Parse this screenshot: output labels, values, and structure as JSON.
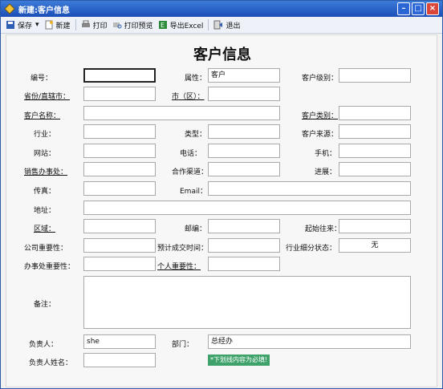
{
  "window": {
    "title": "新建:客户信息"
  },
  "toolbar": {
    "save": "保存",
    "new": "新建",
    "print": "打印",
    "print_preview": "打印预览",
    "export_excel": "导出Excel",
    "exit": "退出"
  },
  "form": {
    "title": "客户信息",
    "labels": {
      "number": "编号：",
      "property": "属性：",
      "level": "客户级别：",
      "province": "省份/直辖市：",
      "city": "市（区）：",
      "name": "客户名称：",
      "category": "客户类别：",
      "industry": "行业：",
      "type": "类型：",
      "source": "客户来源：",
      "website": "网站：",
      "phone": "电话：",
      "mobile": "手机：",
      "sales_office": "销售办事处：",
      "channel": "合作渠道：",
      "progress": "进展：",
      "fax": "传真：",
      "email": "Email：",
      "address": "地址：",
      "region": "区域：",
      "postcode": "邮编：",
      "start_contact": "起始往来：",
      "company_importance": "公司重要性：",
      "expected_deal_time": "预计成交时间：",
      "industry_status": "行业细分状态：",
      "office_importance": "办事处重要性：",
      "personal_importance": "个人重要性：",
      "remark": "备注：",
      "owner": "负责人：",
      "department": "部门：",
      "owner_name": "负责人姓名："
    },
    "values": {
      "property": "客户",
      "industry_status": "无",
      "owner": "she",
      "department": "总经办"
    },
    "required_notice": "*下划线内容为必填!"
  }
}
